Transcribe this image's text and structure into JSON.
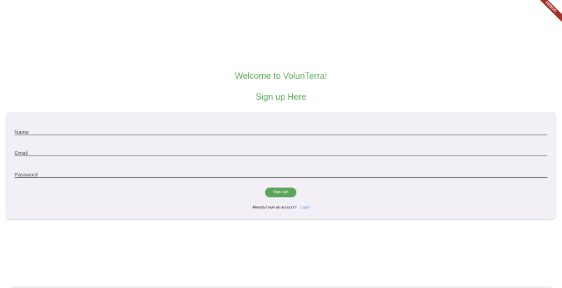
{
  "banner": {
    "label": "DEBUG",
    "color": "#a3302a"
  },
  "header": {
    "welcome": "Welcome to VolunTerra!",
    "signup_title": "Sign up Here",
    "accent_color": "#5cae5c"
  },
  "form": {
    "name_placeholder": "Name",
    "email_placeholder": "Email",
    "password_placeholder": "Password",
    "submit_label": "Sign Up!",
    "button_color": "#5aa55a"
  },
  "footer": {
    "prompt": "Already have an account?",
    "login_label": "Login",
    "link_color": "#4a90d9"
  }
}
